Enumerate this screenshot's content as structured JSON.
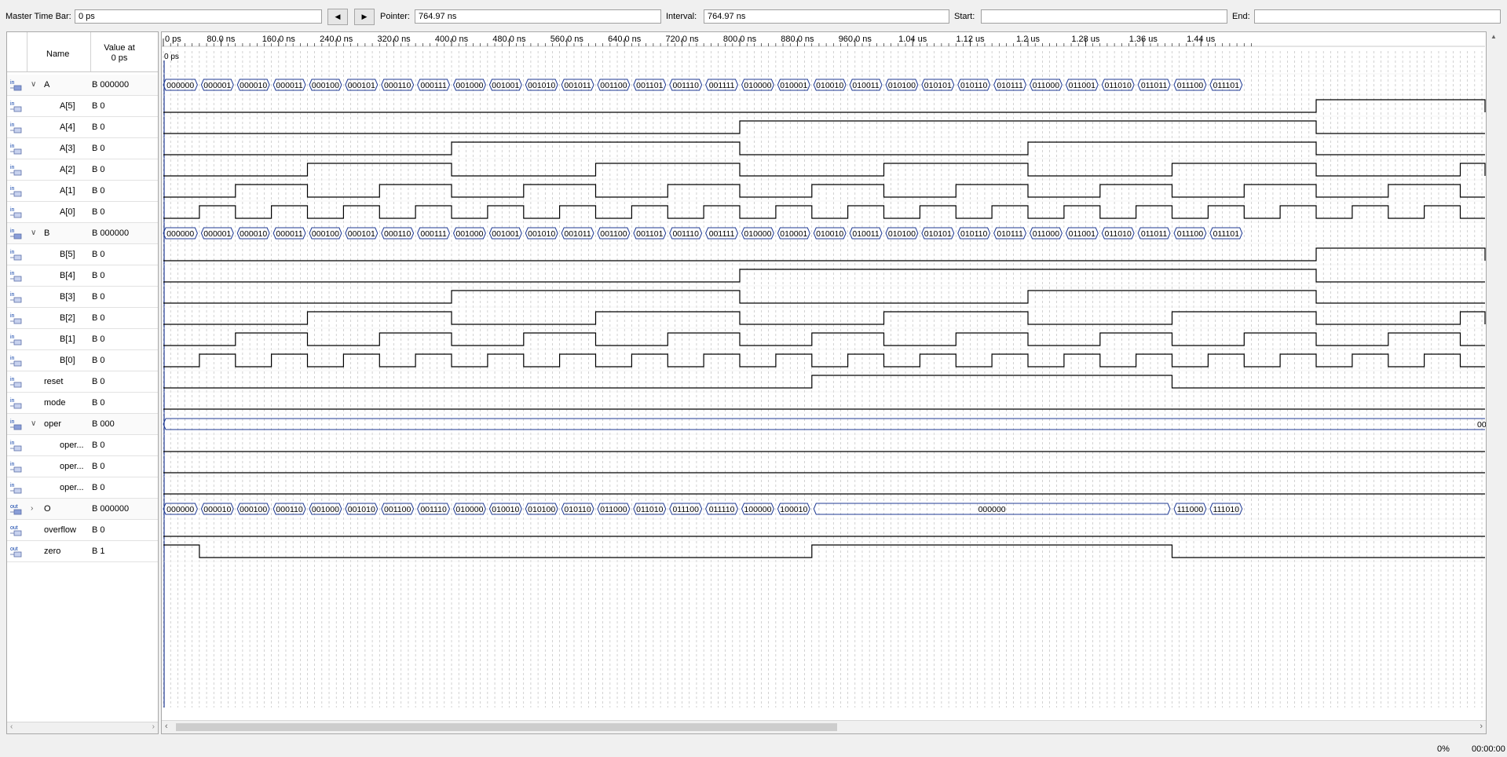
{
  "toolbar": {
    "master_label": "Master Time Bar:",
    "master_value": "0 ps",
    "pointer_label": "Pointer:",
    "pointer_value": "764.97 ns",
    "interval_label": "Interval:",
    "interval_value": "764.97 ns",
    "start_label": "Start:",
    "start_value": "",
    "end_label": "End:",
    "end_value": ""
  },
  "header": {
    "name": "Name",
    "value_at": "Value at",
    "value_time": "0 ps"
  },
  "ruler": {
    "time_bar_label": "0 ps",
    "ticks": [
      "0 ps",
      "80.0 ns",
      "160.0 ns",
      "240.0 ns",
      "320.0 ns",
      "400.0 ns",
      "480.0 ns",
      "560.0 ns",
      "640.0 ns",
      "720.0 ns",
      "800.0 ns",
      "880.0 ns",
      "960.0 ns",
      "1.04 us",
      "1.12 us",
      "1.2 us",
      "1.28 us",
      "1.36 us",
      "1.44 us"
    ]
  },
  "signals": [
    {
      "name": "A",
      "value": "B 000000",
      "kind": "bus",
      "dir": "in",
      "expanded": true,
      "indent": 0
    },
    {
      "name": "A[5]",
      "value": "B 0",
      "kind": "bit",
      "dir": "in",
      "indent": 1
    },
    {
      "name": "A[4]",
      "value": "B 0",
      "kind": "bit",
      "dir": "in",
      "indent": 1
    },
    {
      "name": "A[3]",
      "value": "B 0",
      "kind": "bit",
      "dir": "in",
      "indent": 1
    },
    {
      "name": "A[2]",
      "value": "B 0",
      "kind": "bit",
      "dir": "in",
      "indent": 1
    },
    {
      "name": "A[1]",
      "value": "B 0",
      "kind": "bit",
      "dir": "in",
      "indent": 1
    },
    {
      "name": "A[0]",
      "value": "B 0",
      "kind": "bit",
      "dir": "in",
      "indent": 1
    },
    {
      "name": "B",
      "value": "B 000000",
      "kind": "bus",
      "dir": "in",
      "expanded": true,
      "indent": 0
    },
    {
      "name": "B[5]",
      "value": "B 0",
      "kind": "bit",
      "dir": "in",
      "indent": 1
    },
    {
      "name": "B[4]",
      "value": "B 0",
      "kind": "bit",
      "dir": "in",
      "indent": 1
    },
    {
      "name": "B[3]",
      "value": "B 0",
      "kind": "bit",
      "dir": "in",
      "indent": 1
    },
    {
      "name": "B[2]",
      "value": "B 0",
      "kind": "bit",
      "dir": "in",
      "indent": 1
    },
    {
      "name": "B[1]",
      "value": "B 0",
      "kind": "bit",
      "dir": "in",
      "indent": 1
    },
    {
      "name": "B[0]",
      "value": "B 0",
      "kind": "bit",
      "dir": "in",
      "indent": 1
    },
    {
      "name": "reset",
      "value": "B 0",
      "kind": "bit",
      "dir": "in",
      "indent": 0
    },
    {
      "name": "mode",
      "value": "B 0",
      "kind": "bit",
      "dir": "in",
      "indent": 0
    },
    {
      "name": "oper",
      "value": "B 000",
      "kind": "bus",
      "dir": "in",
      "expanded": true,
      "indent": 0
    },
    {
      "name": "oper...",
      "value": "B 0",
      "kind": "bit",
      "dir": "in",
      "indent": 1
    },
    {
      "name": "oper...",
      "value": "B 0",
      "kind": "bit",
      "dir": "in",
      "indent": 1
    },
    {
      "name": "oper...",
      "value": "B 0",
      "kind": "bit",
      "dir": "in",
      "indent": 1
    },
    {
      "name": "O",
      "value": "B 000000",
      "kind": "bus",
      "dir": "out",
      "expanded": false,
      "indent": 0
    },
    {
      "name": "overflow",
      "value": "B 0",
      "kind": "bit",
      "dir": "out",
      "indent": 0
    },
    {
      "name": "zero",
      "value": "B 1",
      "kind": "bit",
      "dir": "out",
      "indent": 0
    }
  ],
  "waveforms": {
    "time_unit": "ns",
    "period": 50,
    "A_values": [
      "000000",
      "000001",
      "000010",
      "000011",
      "000100",
      "000101",
      "000110",
      "000111",
      "001000",
      "001001",
      "001010",
      "001011",
      "001100",
      "001101",
      "001110",
      "001111",
      "010000",
      "010001",
      "010010",
      "010011",
      "010100",
      "010101",
      "010110",
      "010111",
      "011000",
      "011001",
      "011010",
      "011011",
      "011100",
      "011101"
    ],
    "B_values": [
      "000000",
      "000001",
      "000010",
      "000011",
      "000100",
      "000101",
      "000110",
      "000111",
      "001000",
      "001001",
      "001010",
      "001011",
      "001100",
      "001101",
      "001110",
      "001111",
      "010000",
      "010001",
      "010010",
      "010011",
      "010100",
      "010101",
      "010110",
      "010111",
      "011000",
      "011001",
      "011010",
      "011011",
      "011100",
      "011101"
    ],
    "oper_value": "000",
    "oper_edge_label": "00",
    "O_segments": [
      {
        "start": 0,
        "end": 50,
        "label": "000000"
      },
      {
        "start": 50,
        "end": 100,
        "label": "000010"
      },
      {
        "start": 100,
        "end": 150,
        "label": "000100"
      },
      {
        "start": 150,
        "end": 200,
        "label": "000110"
      },
      {
        "start": 200,
        "end": 250,
        "label": "001000"
      },
      {
        "start": 250,
        "end": 300,
        "label": "001010"
      },
      {
        "start": 300,
        "end": 350,
        "label": "001100"
      },
      {
        "start": 350,
        "end": 400,
        "label": "001110"
      },
      {
        "start": 400,
        "end": 450,
        "label": "010000"
      },
      {
        "start": 450,
        "end": 500,
        "label": "010010"
      },
      {
        "start": 500,
        "end": 550,
        "label": "010100"
      },
      {
        "start": 550,
        "end": 600,
        "label": "010110"
      },
      {
        "start": 600,
        "end": 650,
        "label": "011000"
      },
      {
        "start": 650,
        "end": 700,
        "label": "011010"
      },
      {
        "start": 700,
        "end": 750,
        "label": "011100"
      },
      {
        "start": 750,
        "end": 800,
        "label": "011110"
      },
      {
        "start": 800,
        "end": 850,
        "label": "100000"
      },
      {
        "start": 850,
        "end": 900,
        "label": "100010"
      },
      {
        "start": 900,
        "end": 1400,
        "label": "000000"
      },
      {
        "start": 1400,
        "end": 1450,
        "label": "111000"
      },
      {
        "start": 1450,
        "end": 1500,
        "label": "111010"
      }
    ],
    "reset_high": [
      [
        900,
        1400
      ]
    ],
    "zero_high": [
      [
        0,
        50
      ],
      [
        900,
        1400
      ]
    ]
  },
  "statusbar": {
    "percent": "0%",
    "time": "00:00:00"
  },
  "colors": {
    "wave": "#000000",
    "bus_outline": "#1f3a93",
    "cursor": "#1f3a93",
    "grid": "#b4b4b4"
  }
}
